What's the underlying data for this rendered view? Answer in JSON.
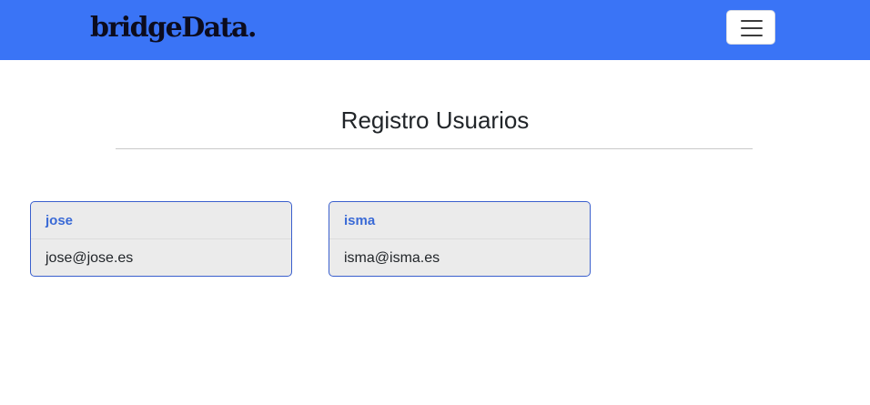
{
  "navbar": {
    "brand": "bridgeData.",
    "toggler_icon": "hamburger-menu-icon"
  },
  "page": {
    "title": "Registro Usuarios"
  },
  "users": [
    {
      "name": "jose",
      "email": "jose@jose.es"
    },
    {
      "name": "isma",
      "email": "isma@isma.es"
    }
  ],
  "colors": {
    "navbar_bg": "#3a74f6",
    "card_border": "#3a5fcd",
    "card_bg": "#ebebeb",
    "card_name": "#3a6ad6"
  }
}
